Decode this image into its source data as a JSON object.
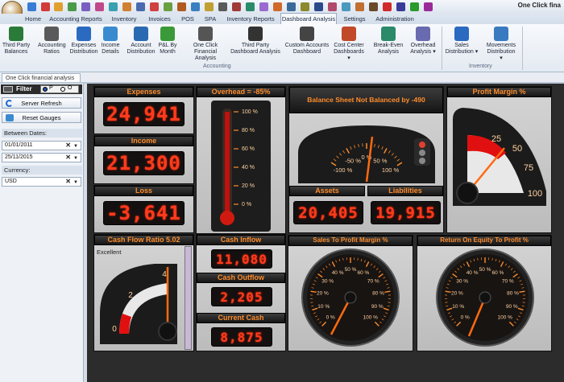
{
  "app": {
    "title": "One Click fina"
  },
  "tabs": [
    {
      "label": "Home"
    },
    {
      "label": "Accounting Reports"
    },
    {
      "label": "Inventory"
    },
    {
      "label": "Invoices"
    },
    {
      "label": "POS"
    },
    {
      "label": "SPA"
    },
    {
      "label": "Inventory Reports"
    },
    {
      "label": "Dashboard Analysis"
    },
    {
      "label": "Settings"
    },
    {
      "label": "Administration"
    }
  ],
  "ribbon": {
    "buttons": [
      {
        "l1": "Third Party",
        "l2": "Balances",
        "icon": "balances-icon"
      },
      {
        "l1": "Accounting",
        "l2": "Ratios",
        "icon": "gauge-icon"
      },
      {
        "l1": "Expenses",
        "l2": "Distribution",
        "icon": "expenses-icon"
      },
      {
        "l1": "Income",
        "l2": "Details",
        "icon": "income-icon"
      },
      {
        "l1": "Account",
        "l2": "Distribution",
        "icon": "account-icon"
      },
      {
        "l1": "P&L By",
        "l2": "Month",
        "icon": "pl-chart-icon"
      },
      {
        "l1": "One Click",
        "l2": "Financial Analysis",
        "icon": "dial-icon"
      },
      {
        "l1": "Third Party",
        "l2": "Dashboard Analysis",
        "icon": "speedometer-icon"
      },
      {
        "l1": "Custom Accounts",
        "l2": "Dashboard",
        "icon": "dashboard-icon"
      },
      {
        "l1": "Cost Center",
        "l2": "Dashboards ▾",
        "icon": "pie-icon"
      },
      {
        "l1": "Break-Even",
        "l2": "Analysis",
        "icon": "break-even-icon"
      },
      {
        "l1": "Overhead",
        "l2": "Analysis ▾",
        "icon": "overhead-icon"
      },
      {
        "l1": "Sales",
        "l2": "Distribution ▾",
        "icon": "sales-icon"
      },
      {
        "l1": "Movements",
        "l2": "Distribution ▾",
        "icon": "movements-icon"
      }
    ],
    "groups": {
      "accounting": "Accounting",
      "inventory": "Inventory"
    }
  },
  "doc_tab": "One Click financial analysis",
  "filter": {
    "title": "Filter",
    "opt1": "P",
    "opt2": "O",
    "server_refresh": "Server Refresh",
    "reset_gauges": "Reset Gauges",
    "between_dates_label": "Between Dates:",
    "date_from": "01/01/2011",
    "date_to": "25/11/2015",
    "currency_label": "Currency:",
    "currency": "USD"
  },
  "dashboard": {
    "expenses": {
      "title": "Expenses",
      "value": "24,941"
    },
    "income": {
      "title": "Income",
      "value": "21,300"
    },
    "loss": {
      "title": "Loss",
      "value": "-3,641"
    },
    "overhead": {
      "title": "Overhead = -85%",
      "ticks": [
        "100 %",
        "80 %",
        "60 %",
        "40 %",
        "20 %",
        "0 %"
      ]
    },
    "balance": {
      "title": "Balance Sheet Not Balanced by -490",
      "ticks": [
        "-100 %",
        "-50 %",
        "0 %",
        "50 %",
        "100 %"
      ]
    },
    "assets": {
      "title": "Assets",
      "value": "20,405"
    },
    "liabilities": {
      "title": "Liabilities",
      "value": "19,915"
    },
    "profit_margin": {
      "title": "Profit Margin %",
      "ticks": [
        "25",
        "50",
        "75",
        "100"
      ]
    },
    "cash_flow": {
      "title": "Cash Flow Ratio 5.02",
      "rating": "Excellent",
      "ticks": [
        "0",
        "2",
        "4"
      ]
    },
    "cash_inflow": {
      "title": "Cash Inflow",
      "value": "11,080"
    },
    "cash_outflow": {
      "title": "Cash Outflow",
      "value": "2,205"
    },
    "current_cash": {
      "title": "Current Cash",
      "value": "8,875"
    },
    "sales_to_profit": {
      "title": "Sales To Profit Margin %",
      "ticks": [
        "0 %",
        "10 %",
        "20 %",
        "30 %",
        "40 %",
        "50 %",
        "60 %",
        "70 %",
        "80 %",
        "90 %",
        "100 %"
      ]
    },
    "roe": {
      "title": "Return On Equity To Profit %",
      "ticks": [
        "0 %",
        "10 %",
        "20 %",
        "30 %",
        "40 %",
        "50 %",
        "60 %",
        "70 %",
        "80 %",
        "90 %",
        "100 %"
      ]
    }
  },
  "colors": {
    "accent": "#ff8c2a",
    "led": "#ff3b1d",
    "needle": "#ff6a10",
    "ribbon_bg": "#e4eaf2"
  }
}
